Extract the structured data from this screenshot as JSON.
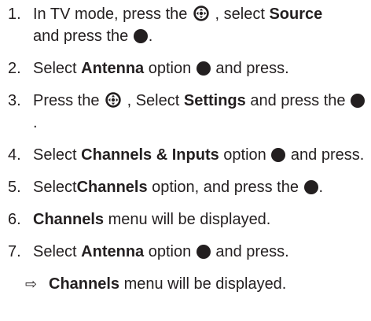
{
  "steps": [
    {
      "num": "1.",
      "t1": "In TV mode, press the ",
      "t2": " , select ",
      "b1": "Source",
      "t3": "and press the ",
      "t4": "."
    },
    {
      "num": "2.",
      "t1": "Select ",
      "b1": "Antenna",
      "t2": " option ",
      "t3": " and press."
    },
    {
      "num": "3.",
      "t1": "Press the ",
      "t2": " , Select ",
      "b1": "Settings",
      "t3": " and press the ",
      "t4": "."
    },
    {
      "num": "4.",
      "t1": "Select ",
      "b1": "Channels & Inputs",
      "t2": " option ",
      "t3": " and press."
    },
    {
      "num": "5.",
      "t1": "Select",
      "b1": "Channels",
      "t2": " option, and press the ",
      "t3": "."
    },
    {
      "num": "6.",
      "b1": "Channels",
      "t1": " menu will be displayed."
    },
    {
      "num": "7.",
      "t1": "Select ",
      "b1": "Antenna",
      "t2": " option ",
      "t3": " and press."
    }
  ],
  "result": {
    "arrow": "⇨",
    "b1": "Channels",
    "t1": " menu will be displayed."
  },
  "icons": {
    "navigation": "navigation-pad-icon",
    "ok": "ok-button-icon"
  }
}
